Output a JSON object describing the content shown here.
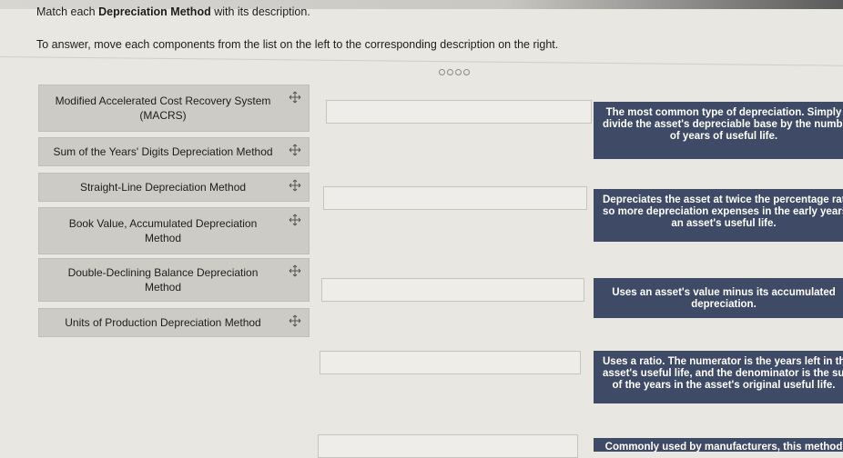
{
  "header": {
    "title_prefix": "Match each ",
    "title_bold": "Depreciation Method",
    "title_suffix": " with its description.",
    "instruction": "To answer, move each components from the list on the left to the corresponding description on the right."
  },
  "pager": {
    "dots": 4
  },
  "methods": [
    {
      "label": "Modified Accelerated Cost Recovery System\n(MACRS)",
      "icon": "move-arrows-icon"
    },
    {
      "label": "Sum of the Years' Digits Depreciation Method",
      "icon": "move-arrows-icon"
    },
    {
      "label": "Straight-Line Depreciation Method",
      "icon": "move-arrows-icon"
    },
    {
      "label": "Book Value, Accumulated Depreciation\nMethod",
      "icon": "move-arrows-icon"
    },
    {
      "label": "Double-Declining Balance Depreciation\nMethod",
      "icon": "move-arrows-icon"
    },
    {
      "label": "Units of Production Depreciation Method",
      "icon": "move-arrows-icon"
    }
  ],
  "descriptions": [
    {
      "lines": [
        "The most common type of depreciation. Simply",
        "divide the asset's depreciable base by the numbe",
        "of years of useful life."
      ]
    },
    {
      "lines": [
        "Depreciates the asset at twice the percentage rate",
        "so more depreciation expenses in the early years o",
        "an asset's useful life."
      ]
    },
    {
      "lines": [
        "Uses an asset's value minus its accumulated",
        "depreciation."
      ]
    },
    {
      "lines": [
        "Uses a ratio. The numerator is the years left in the",
        "asset's useful life, and the denominator is the sum",
        "of the years in the asset's original useful life."
      ]
    },
    {
      "lines": [
        "Commonly used by manufacturers, this method"
      ]
    }
  ],
  "colors": {
    "background": "#e9e7e2",
    "source_tile": "#cdcbc6",
    "description_tile": "#3f4a66",
    "drop_zone": "#efede9"
  }
}
